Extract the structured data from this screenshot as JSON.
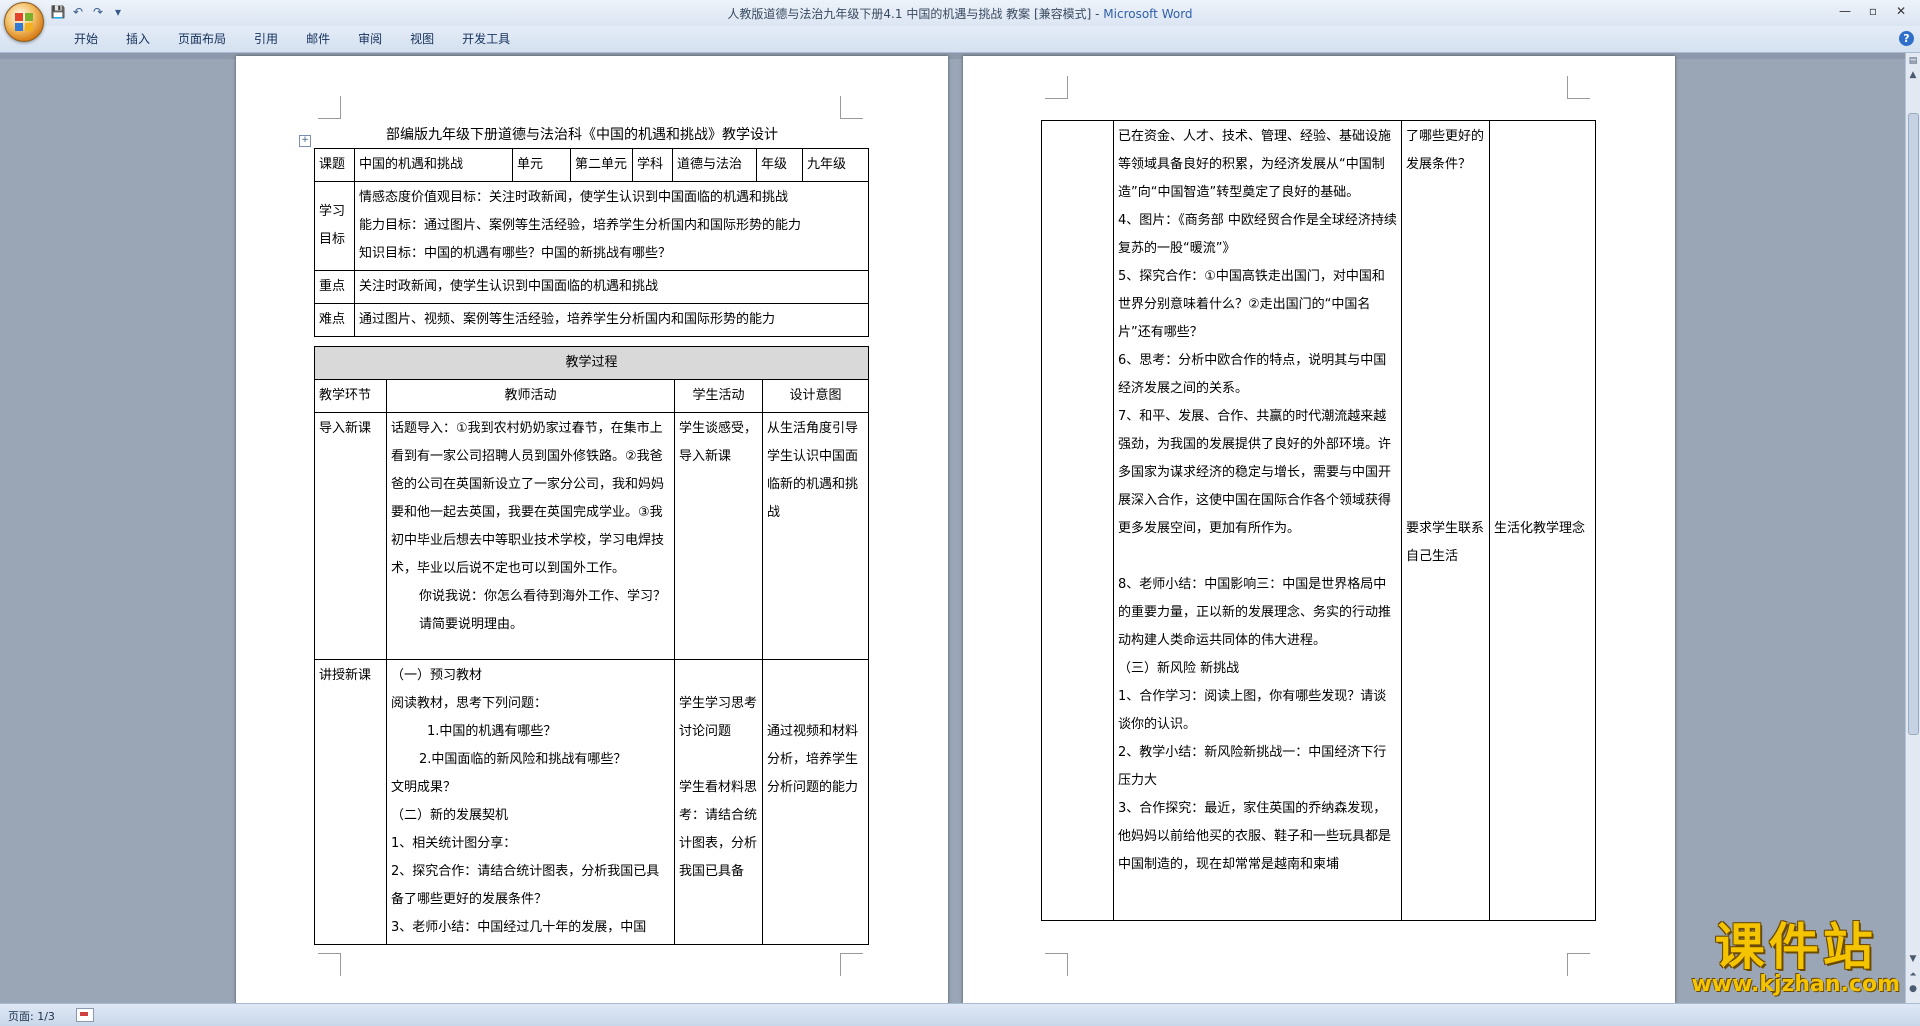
{
  "window": {
    "title": "人教版道德与法治九年级下册4.1  中国的机遇与挑战    教案 [兼容模式] - ",
    "app_name": "Microsoft Word",
    "controls": {
      "minimize": "—",
      "maximize": "▫",
      "close": "✕"
    }
  },
  "quick_access": {
    "save": "💾",
    "undo": "↶",
    "redo": "↷",
    "more": "▾"
  },
  "ribbon": {
    "tabs": [
      "开始",
      "插入",
      "页面布局",
      "引用",
      "邮件",
      "审阅",
      "视图",
      "开发工具"
    ],
    "help": "?"
  },
  "status": {
    "page": "页面: 1/3"
  },
  "watermark": {
    "cn": "课件站",
    "url": "www.kjzhan.com"
  },
  "page1": {
    "title": "部编版九年级下册道德与法治科《中国的机遇和挑战》教学设计",
    "info": {
      "c1": "课题",
      "c2": "中国的机遇和挑战",
      "c3": "单元",
      "c4": "第二单元",
      "c5": "学科",
      "c6": "道德与法治",
      "c7": "年级",
      "c8": "九年级"
    },
    "objectives": {
      "label": "学习目标",
      "lines": [
        "情感态度价值观目标：关注时政新闻，使学生认识到中国面临的机遇和挑战",
        "能力目标：通过图片、案例等生活经验，培养学生分析国内和国际形势的能力",
        "知识目标：中国的机遇有哪些？中国的新挑战有哪些？"
      ]
    },
    "focus": {
      "label": "重点",
      "text": "关注时政新闻，使学生认识到中国面临的机遇和挑战"
    },
    "difficulty": {
      "label": "难点",
      "text": "通过图片、视频、案例等生活经验，培养学生分析国内和国际形势的能力"
    },
    "process_header": "教学过程",
    "columns": [
      "教学环节",
      "教师活动",
      "学生活动",
      "设计意图"
    ],
    "intro": {
      "stage": "导入新课",
      "teacher_1": "话题导入：①我到农村奶奶家过春节，在集市上看到有一家公司招聘人员到国外修铁路。②我爸爸的公司在英国新设立了一家分公司，我和妈妈要和他一起去英国，我要在英国完成学业。③我初中毕业后想去中等职业技术学校，学习电焊技术，毕业以后说不定也可以到国外工作。",
      "teacher_2": "你说我说：你怎么看待到海外工作、学习？请简要说明理由。",
      "student": "学生谈感受，导入新课",
      "intent": "从生活角度引导学生认识中国面临新的机遇和挑战"
    },
    "lecture": {
      "stage": "讲授新课",
      "teacher": [
        "（一）预习教材",
        "阅读教材，思考下列问题：",
        "1.中国的机遇有哪些？",
        "2.中国面临的新风险和挑战有哪些？",
        "文明成果？",
        "（二）新的发展契机",
        "1、相关统计图分享：",
        "2、探究合作：请结合统计图表，分析我国已具备了哪些更好的发展条件？",
        "3、老师小结：中国经过几十年的发展，中国"
      ],
      "student_1": "学生学习思考讨论问题",
      "student_2": "学生看材料思考：请结合统计图表，分析我国已具备",
      "intent": "通过视频和材料分析，培养学生分析问题的能力"
    }
  },
  "page2": {
    "teacher": [
      "已在资金、人才、技术、管理、经验、基础设施等领域具备良好的积累，为经济发展从“中国制造”向“中国智造”转型奠定了良好的基础。",
      "4、图片：《商务部 中欧经贸合作是全球经济持续复苏的一股“暖流”》",
      "5、探究合作：①中国高铁走出国门，对中国和世界分别意味着什么？②走出国门的“中国名片”还有哪些？",
      "6、思考：分析中欧合作的特点，说明其与中国经济发展之间的关系。",
      "7、和平、发展、合作、共赢的时代潮流越来越强劲，为我国的发展提供了良好的外部环境。许多国家为谋求经济的稳定与增长，需要与中国开展深入合作，这使中国在国际合作各个领域获得更多发展空间，更加有所作为。",
      "",
      "8、老师小结：中国影响三：中国是世界格局中的重要力量，正以新的发展理念、务实的行动推动构建人类命运共同体的伟大进程。",
      "（三）新风险  新挑战",
      "1、合作学习：阅读上图，你有哪些发现？请谈谈你的认识。",
      "2、教学小结：新风险新挑战一：中国经济下行压力大",
      "3、合作探究：最近，家住英国的乔纳森发现，他妈妈以前给他买的衣服、鞋子和一些玩具都是中国制造的，现在却常常是越南和柬埔"
    ],
    "student_1": "了哪些更好的发展条件？",
    "student_2": "要求学生联系自己生活",
    "intent": "生活化教学理念"
  }
}
